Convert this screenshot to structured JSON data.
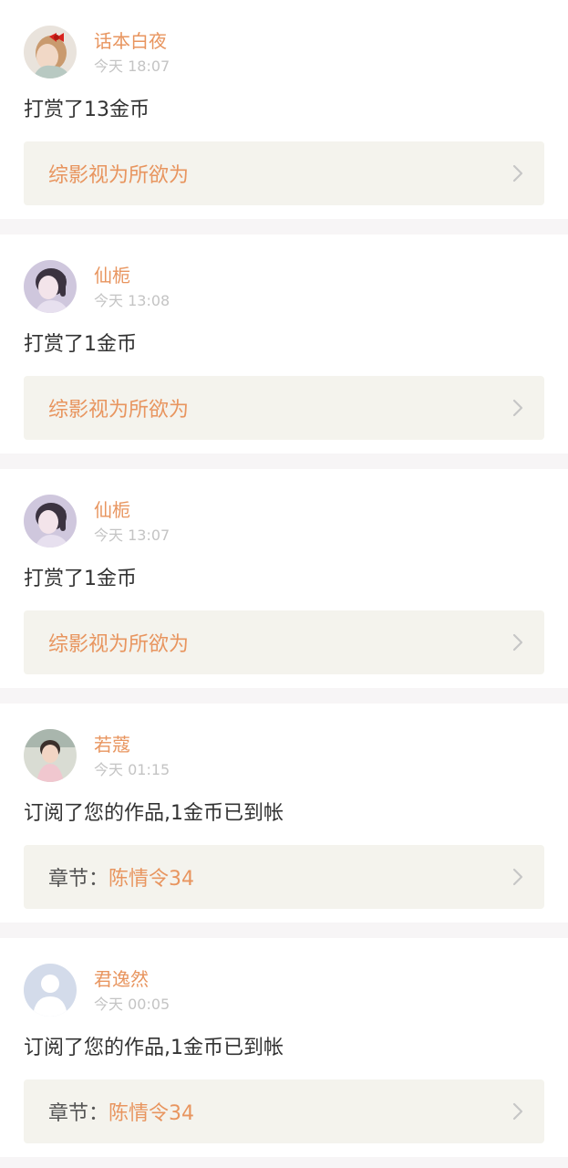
{
  "notifications": [
    {
      "username": "话本白夜",
      "time": "今天 18:07",
      "action": "打赏了13金币",
      "link_prefix": "",
      "link_title": "综影视为所欲为",
      "avatar": "photo-girl-red-bow"
    },
    {
      "username": "仙栀",
      "time": "今天 13:08",
      "action": "打赏了1金币",
      "link_prefix": "",
      "link_title": "综影视为所欲为",
      "avatar": "photo-girl-purple"
    },
    {
      "username": "仙栀",
      "time": "今天 13:07",
      "action": "打赏了1金币",
      "link_prefix": "",
      "link_title": "综影视为所欲为",
      "avatar": "photo-girl-purple"
    },
    {
      "username": "若蔻",
      "time": "今天 01:15",
      "action": "订阅了您的作品,1金币已到帐",
      "link_prefix": "章节：",
      "link_title": "陈情令34",
      "avatar": "photo-child"
    },
    {
      "username": "君逸然",
      "time": "今天 00:05",
      "action": "订阅了您的作品,1金币已到帐",
      "link_prefix": "章节：",
      "link_title": "陈情令34",
      "avatar": "default-user"
    }
  ],
  "colors": {
    "accent": "#e8955f",
    "page_bg": "#f7f5f6",
    "link_bg": "#f4f3ed",
    "muted": "#c4c4c4",
    "text": "#333333"
  },
  "icons": {
    "chevron": "chevron-right-icon"
  }
}
